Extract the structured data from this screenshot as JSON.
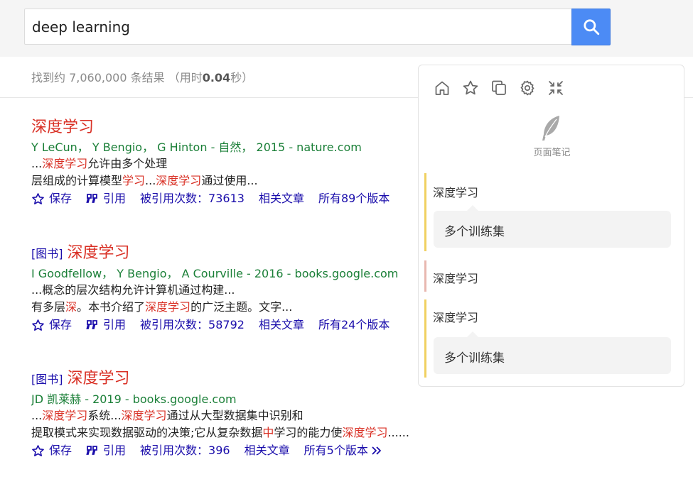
{
  "search": {
    "query": "deep learning"
  },
  "stats": {
    "prefix": "找到约 7,060,000 条结果  （用时",
    "time": "0.04",
    "suffix": "秒）"
  },
  "actions": {
    "save": "保存",
    "cite": "引用",
    "cited_by_prefix": "被引用次数：",
    "related": "相关文章",
    "all_versions_prefix": "所有 ",
    "all_versions_suffix": " 个版本"
  },
  "results": [
    {
      "title": "深度学习",
      "authors": "Y LeCun， Y Bengio， G Hinton - 自然， 2015 - nature.com",
      "line1": {
        "a": "...",
        "b": "深度学习",
        "c": "允许由多个处理"
      },
      "line2": {
        "a": "层组成的计算模型",
        "b": "学习",
        "c": "...",
        "d": "深度学习",
        "e": "通过使用..."
      },
      "cited_by": "73613",
      "versions": "89"
    },
    {
      "tag": "[图书]",
      "title": "深度学习",
      "authors": "I Goodfellow， Y Bengio， A Courville - 2016 - books.google.com",
      "line1": {
        "a": "...概念的层次结构允许计算机通过构建..."
      },
      "line2": {
        "a": "有多层",
        "b": "深",
        "c": "。本书介绍了",
        "d": "深度学习",
        "e": "的广泛主题。文字..."
      },
      "cited_by": "58792",
      "versions": "24"
    },
    {
      "tag": "[图书]",
      "title": "深度学习",
      "authors": "JD 凯莱赫 - 2019 - books.google.com",
      "line1": {
        "a": "...",
        "b": "深度学习",
        "c": "系统...",
        "d": "深度学习",
        "e": "通过从大型数据集中识别和"
      },
      "line2": {
        "a": "提取模式来实现数据驱动的决策;它从复杂数据",
        "b": "中",
        "c": "学习的能力使",
        "d": "深度学习",
        "e": "......"
      },
      "cited_by": "396",
      "versions": "5"
    }
  ],
  "panel": {
    "note_label": "页面笔记",
    "notes": [
      {
        "title": "深度学习",
        "body": "多个训练集"
      },
      {
        "title": "深度学习"
      },
      {
        "title": "深度学习",
        "body": "多个训练集"
      }
    ]
  },
  "colors": {
    "accent_blue": "#4c8bf5",
    "link": "#1a0dab",
    "title_red": "#d93025",
    "author_green": "#1a7f37",
    "note_yellow": "#f0d060",
    "note_pink": "#e8b8b0"
  },
  "icons": [
    "search-icon",
    "star-icon",
    "quote-icon",
    "chevrons-right-icon",
    "home-icon",
    "copy-icon",
    "gear-icon",
    "collapse-icon",
    "feather-icon"
  ]
}
